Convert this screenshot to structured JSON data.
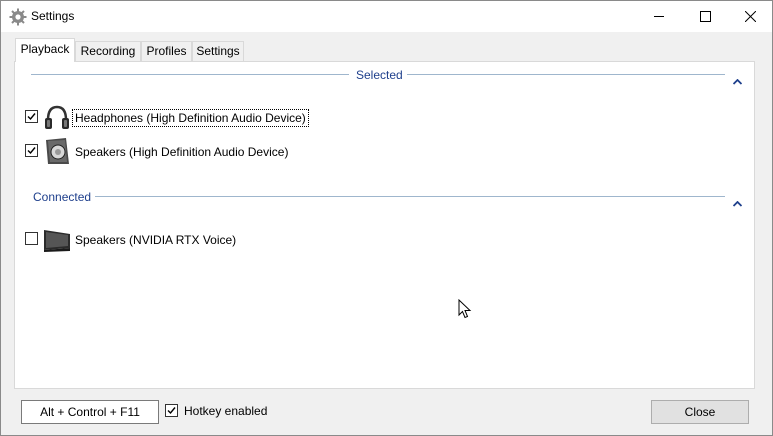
{
  "window": {
    "title": "Settings",
    "icon": "gear-icon",
    "controls": [
      "minimize-icon",
      "maximize-icon",
      "close-icon"
    ]
  },
  "tabs": [
    {
      "label": "Playback",
      "active": true
    },
    {
      "label": "Recording",
      "active": false
    },
    {
      "label": "Profiles",
      "active": false
    },
    {
      "label": "Settings",
      "active": false
    }
  ],
  "groups": {
    "selected": {
      "title": "Selected",
      "devices": [
        {
          "label": "Headphones (High Definition Audio Device)",
          "checked": true,
          "icon": "headphones-icon"
        },
        {
          "label": "Speakers (High Definition Audio Device)",
          "checked": true,
          "icon": "speaker-icon"
        }
      ]
    },
    "connected": {
      "title": "Connected",
      "devices": [
        {
          "label": "Speakers (NVIDIA RTX Voice)",
          "checked": false,
          "icon": "monitor-icon"
        }
      ]
    }
  },
  "footer": {
    "hotkey": "Alt + Control + F11",
    "hotkey_enabled_label": "Hotkey enabled",
    "hotkey_enabled": true,
    "close_label": "Close"
  },
  "colors": {
    "group_title": "#1e3f8c",
    "group_line": "#9fb6cd",
    "panel_bg": "#ffffff",
    "window_bg": "#f0f0f0"
  }
}
